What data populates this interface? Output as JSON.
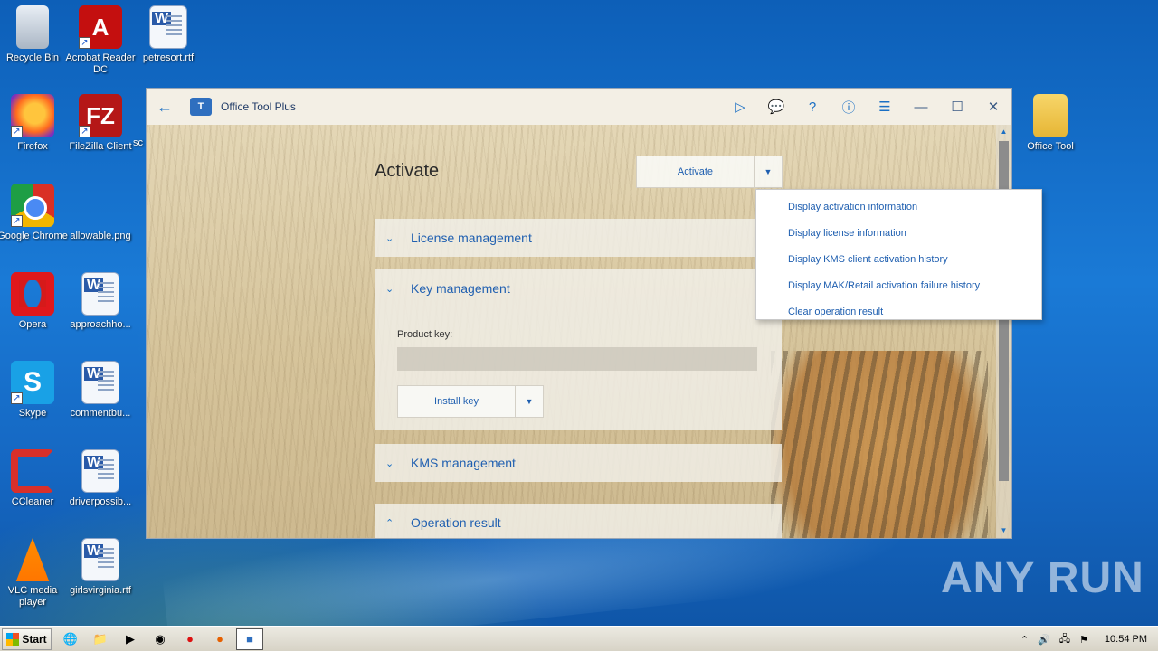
{
  "desktop": {
    "icons": [
      {
        "label": "Recycle Bin"
      },
      {
        "label": "Acrobat Reader DC"
      },
      {
        "label": "petresort.rtf"
      },
      {
        "label": "Firefox"
      },
      {
        "label": "FileZilla Client"
      },
      {
        "label": "sc"
      },
      {
        "label": "Google Chrome"
      },
      {
        "label": "allowable.png"
      },
      {
        "label": "Opera"
      },
      {
        "label": "approachho..."
      },
      {
        "label": "Skype"
      },
      {
        "label": "commentbu..."
      },
      {
        "label": "CCleaner"
      },
      {
        "label": "driverpossib..."
      },
      {
        "label": "VLC media player"
      },
      {
        "label": "girlsvirginia.rtf"
      },
      {
        "label": "Office Tool"
      }
    ],
    "watermark": "ANY RUN"
  },
  "window": {
    "title": "Office Tool Plus",
    "page_title": "Activate",
    "activate_button": "Activate",
    "sections": {
      "license": "License management",
      "key": "Key management",
      "kms": "KMS management",
      "operation": "Operation result"
    },
    "product_key_label": "Product key:",
    "install_key_button": "Install key",
    "menu": [
      "Display activation information",
      "Display license information",
      "Display KMS client activation history",
      "Display MAK/Retail activation failure history",
      "Clear operation result"
    ]
  },
  "taskbar": {
    "start_label": "Start",
    "clock": "10:54 PM"
  }
}
